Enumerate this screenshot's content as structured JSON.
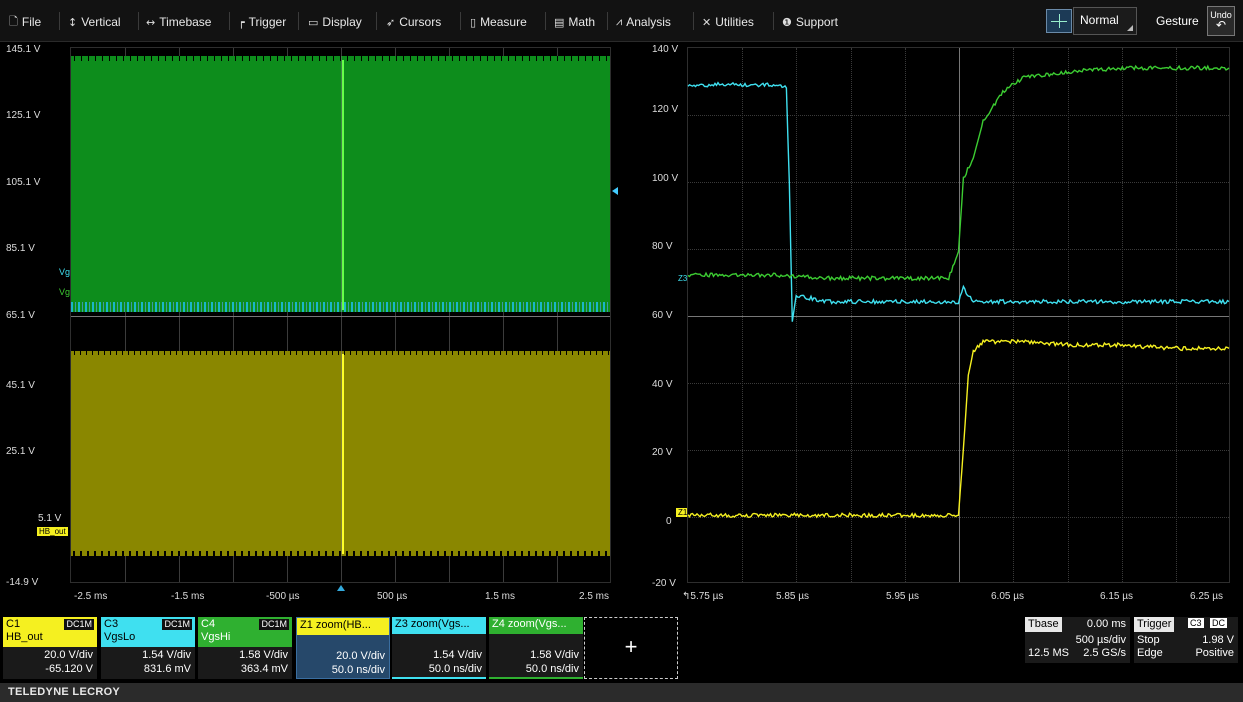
{
  "menu": {
    "items": [
      {
        "name": "file",
        "label": "File",
        "icon": "file-icon"
      },
      {
        "name": "vertical",
        "label": "Vertical",
        "icon": "vertical-arrow-icon"
      },
      {
        "name": "timebase",
        "label": "Timebase",
        "icon": "horizontal-arrow-icon"
      },
      {
        "name": "trigger",
        "label": "Trigger",
        "icon": "trigger-icon"
      },
      {
        "name": "display",
        "label": "Display",
        "icon": "display-icon"
      },
      {
        "name": "cursors",
        "label": "Cursors",
        "icon": "cursor-icon"
      },
      {
        "name": "measure",
        "label": "Measure",
        "icon": "measure-icon"
      },
      {
        "name": "math",
        "label": "Math",
        "icon": "calculator-icon"
      },
      {
        "name": "analysis",
        "label": "Analysis",
        "icon": "chart-icon"
      },
      {
        "name": "utilities",
        "label": "Utilities",
        "icon": "tools-icon"
      },
      {
        "name": "support",
        "label": "Support",
        "icon": "info-icon"
      }
    ],
    "trigger_mode": "Normal",
    "gesture": "Gesture",
    "undo": "Undo"
  },
  "left_grid": {
    "y_ticks": [
      "145.1 V",
      "125.1 V",
      "105.1 V",
      "85.1 V",
      "65.1 V",
      "45.1 V",
      "25.1 V",
      "5.1 V",
      "-14.9 V"
    ],
    "x_ticks": [
      "-2.5 ms",
      "-1.5 ms",
      "-500 µs",
      "500 µs",
      "1.5 ms",
      "2.5 ms"
    ],
    "markers": {
      "vg_cyan": "Vg",
      "vg_green": "Vg",
      "hb_out": "HB_out"
    }
  },
  "chart_data": {
    "type": "line",
    "x_unit": "µs",
    "y_unit": "V",
    "x_ticks": [
      "5.75 µs",
      "5.85 µs",
      "5.95 µs",
      "6.05 µs",
      "6.15 µs",
      "6.25 µs"
    ],
    "y_ticks": [
      "140 V",
      "120 V",
      "100 V",
      "80 V",
      "60 V",
      "40 V",
      "20 V",
      "0",
      "-20 V"
    ],
    "xlim": [
      5.71,
      6.26
    ],
    "ylim": [
      -20,
      140
    ],
    "markers": {
      "z1": "Z1",
      "z3": "Z3"
    },
    "series": [
      {
        "color": "#3fe0f0",
        "x": [
          5.71,
          5.8,
          5.81,
          5.813,
          5.816,
          5.82,
          5.85,
          5.9,
          5.95,
          5.985,
          5.99,
          6.0,
          6.05,
          6.1,
          6.15,
          6.2,
          6.26
        ],
        "y": [
          129,
          129,
          128,
          100,
          58,
          66,
          64,
          64,
          64,
          64,
          68,
          64,
          64,
          64,
          64,
          64,
          64
        ]
      },
      {
        "color": "#3ccc32",
        "x": [
          5.71,
          5.8,
          5.85,
          5.9,
          5.95,
          5.975,
          5.985,
          5.99,
          6.0,
          6.01,
          6.03,
          6.05,
          6.1,
          6.15,
          6.2,
          6.26
        ],
        "y": [
          72,
          72,
          71,
          71,
          71,
          71,
          79,
          101,
          107,
          118,
          127,
          131,
          133,
          134,
          134,
          134
        ]
      },
      {
        "color": "#f5f020",
        "x": [
          5.71,
          5.8,
          5.9,
          5.95,
          5.985,
          5.99,
          5.995,
          6.0,
          6.01,
          6.05,
          6.1,
          6.15,
          6.2,
          6.26
        ],
        "y": [
          0,
          0,
          0,
          0,
          0,
          20,
          42,
          49,
          52,
          52,
          51,
          51,
          50,
          50
        ]
      }
    ]
  },
  "channels": [
    {
      "id": "C1",
      "name": "HB_out",
      "coupling": "DC1M",
      "vdiv": "20.0 V/div",
      "offset": "-65.120 V",
      "color": "#f5f020"
    },
    {
      "id": "C3",
      "name": "VgsLo",
      "coupling": "DC1M",
      "vdiv": "1.54 V/div",
      "offset": "831.6 mV",
      "color": "#3fe0f0"
    },
    {
      "id": "C4",
      "name": "VgsHi",
      "coupling": "DC1M",
      "vdiv": "1.58 V/div",
      "offset": "363.4 mV",
      "color": "#3ccc32"
    }
  ],
  "zooms": [
    {
      "id": "Z1",
      "title": "zoom(HB...",
      "vdiv": "20.0 V/div",
      "tdiv": "50.0 ns/div",
      "color": "#f5f020"
    },
    {
      "id": "Z3",
      "title": "zoom(Vgs...",
      "vdiv": "1.54 V/div",
      "tdiv": "50.0 ns/div",
      "color": "#3fe0f0"
    },
    {
      "id": "Z4",
      "title": "zoom(Vgs...",
      "vdiv": "1.58 V/div",
      "tdiv": "50.0 ns/div",
      "color": "#3ccc32"
    }
  ],
  "add_button": "+",
  "timebase": {
    "label": "Tbase",
    "delay": "0.00 ms",
    "tdiv": "500 µs/div",
    "samples": "12.5 MS",
    "rate": "2.5 GS/s"
  },
  "trigger": {
    "label": "Trigger",
    "source": "C3",
    "coupling": "DC",
    "mode": "Stop",
    "level": "1.98 V",
    "type": "Edge",
    "slope": "Positive"
  },
  "brand": "TELEDYNE LECROY"
}
